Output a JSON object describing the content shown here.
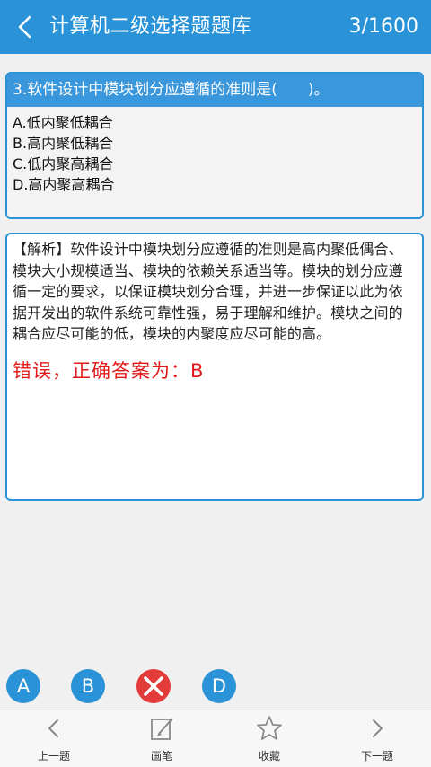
{
  "header": {
    "title": "计算机二级选择题题库",
    "progress": "3/1600"
  },
  "question": {
    "text": "3.软件设计中模块划分应遵循的准则是(　　)。",
    "options": [
      "A.低内聚低耦合",
      "B.高内聚低耦合",
      "C.低内聚高耦合",
      "D.高内聚高耦合"
    ]
  },
  "analysis": {
    "text": "【解析】软件设计中模块划分应遵循的准则是高内聚低偶合、模块大小规模适当、模块的依赖关系适当等。模块的划分应遵循一定的要求，以保证模块划分合理，并进一步保证以此为依据开发出的软件系统可靠性强，易于理解和维护。模块之间的耦合应尽可能的低，模块的内聚度应尽可能的高。",
    "verdict": "错误，正确答案为：B"
  },
  "answer_buttons": [
    {
      "label": "A",
      "icon": "option-a",
      "state": "normal"
    },
    {
      "label": "B",
      "icon": "option-b",
      "state": "normal"
    },
    {
      "label": "",
      "icon": "x-icon",
      "state": "wrong"
    },
    {
      "label": "D",
      "icon": "option-d",
      "state": "normal"
    }
  ],
  "bottom_nav": [
    {
      "label": "上一题",
      "icon": "chevron-left-icon"
    },
    {
      "label": "画笔",
      "icon": "pen-icon"
    },
    {
      "label": "收藏",
      "icon": "star-icon"
    },
    {
      "label": "下一题",
      "icon": "chevron-right-icon"
    }
  ],
  "colors": {
    "primary": "#2a93d8",
    "wrong": "#e33a3a",
    "verdict_text": "#e01a1a"
  }
}
